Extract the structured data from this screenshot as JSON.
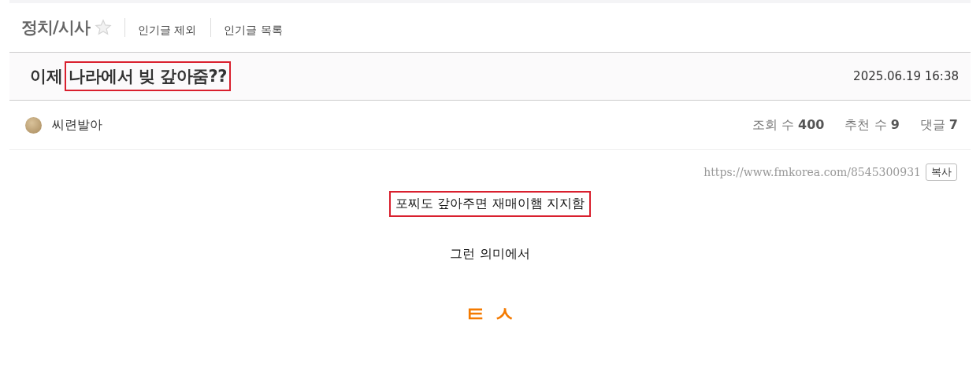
{
  "board": {
    "name": "정치/시사",
    "favorite": false,
    "links": [
      "인기글 제외",
      "인기글 목록"
    ]
  },
  "post": {
    "title_parts": [
      {
        "text": "이제",
        "highlighted": false
      },
      {
        "text": "나라에서 빚 갚아줌??",
        "highlighted": true
      }
    ],
    "date": "2025.06.19 16:38",
    "author": "씨련발아",
    "stats": [
      {
        "label": "조회 수",
        "value": "400"
      },
      {
        "label": "추천 수",
        "value": "9"
      },
      {
        "label": "댓글",
        "value": "7"
      }
    ],
    "url": "https://www.fmkorea.com/8545300931",
    "copy_button": "복사",
    "paragraphs": [
      {
        "text": "포찌도 갚아주면 재매이햄 지지함",
        "kind": "plain",
        "highlighted": true
      },
      {
        "text": "그런 의미에서",
        "kind": "plain",
        "highlighted": false
      },
      {
        "text": "ㅌ ㅅ",
        "kind": "big",
        "highlighted": false
      }
    ]
  }
}
